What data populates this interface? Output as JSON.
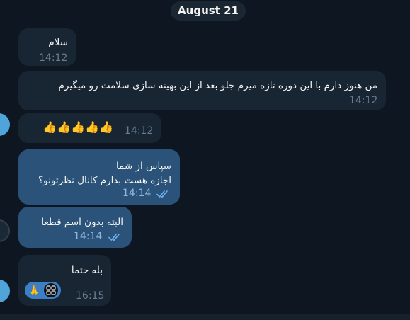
{
  "chat": {
    "date_label": "August 21",
    "messages": [
      {
        "text": "سلام",
        "time": "14:12",
        "direction": "in"
      },
      {
        "text": "من هنوز دارم با این دوره تازه میرم جلو بعد از این بهینه سازی سلامت رو میگیرم",
        "time": "14:12",
        "direction": "in"
      },
      {
        "text": "👍👍👍👍👍",
        "time": "14:12",
        "direction": "in"
      },
      {
        "lines": [
          "سپاس از شما",
          "اجازه هست بذارم کانال نظرتونو؟"
        ],
        "time": "14:14",
        "direction": "out",
        "status": "read"
      },
      {
        "text": "البته بدون اسم قطعا",
        "time": "14:14",
        "direction": "out",
        "status": "read"
      },
      {
        "text": "بله حتما",
        "time": "16:15",
        "direction": "in",
        "reaction": "🙏"
      }
    ]
  },
  "colors": {
    "background": "#0e1621",
    "incoming_bubble": "#182533",
    "outgoing_bubble": "#2b5278",
    "read_check": "#6bb2f0",
    "avatar": "#4fa5d9"
  }
}
